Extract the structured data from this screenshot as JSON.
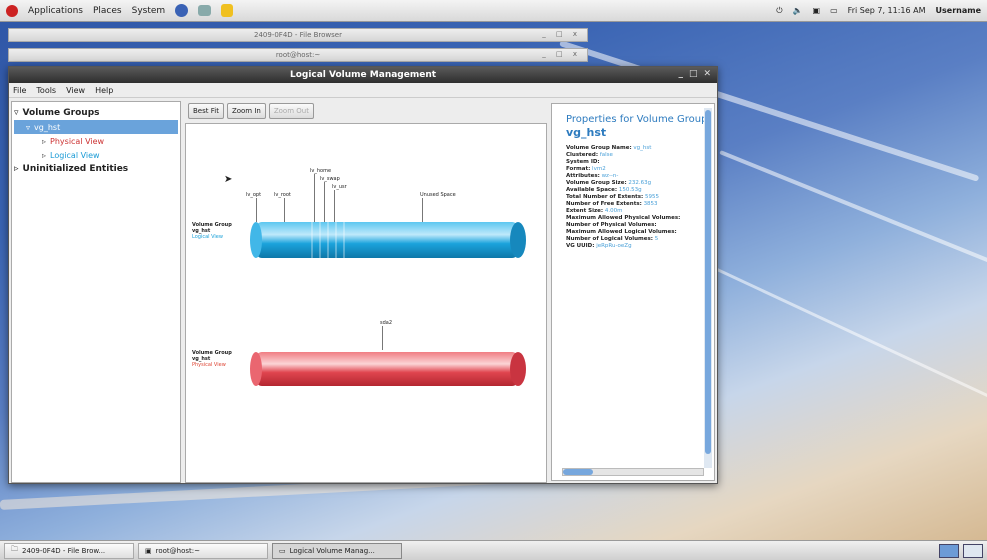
{
  "panel": {
    "menus": [
      "Applications",
      "Places",
      "System"
    ],
    "clock": "Fri Sep 7, 11:16 AM",
    "user": "Username"
  },
  "background_windows": [
    {
      "title": "2409-0F4D - File Browser"
    },
    {
      "title": "root@host:~"
    }
  ],
  "window": {
    "title": "Logical Volume Management",
    "menus": [
      "File",
      "Tools",
      "View",
      "Help"
    ]
  },
  "tree": {
    "volume_groups": "Volume Groups",
    "vg": "vg_hst",
    "physical_view": "Physical View",
    "logical_view": "Logical View",
    "uninitialized": "Uninitialized Entities"
  },
  "toolbar": {
    "best_fit": "Best Fit",
    "zoom_in": "Zoom In",
    "zoom_out": "Zoom Out"
  },
  "diagram": {
    "logical": {
      "title": "Volume Group",
      "name": "vg_hst",
      "view": "Logical View",
      "volumes": [
        "lv_opt",
        "lv_root",
        "lv_home",
        "lv_swap",
        "lv_usr",
        "Unused Space"
      ]
    },
    "physical": {
      "title": "Volume Group",
      "name": "vg_hst",
      "view": "Physical View",
      "volumes": [
        "sda2"
      ]
    }
  },
  "properties": {
    "heading": "Properties for Volume Group",
    "name": "vg_hst",
    "rows": [
      {
        "k": "Volume Group Name:",
        "v": "vg_hst"
      },
      {
        "k": "Clustered:",
        "v": "false"
      },
      {
        "k": "System ID:",
        "v": ""
      },
      {
        "k": "Format:",
        "v": "lvm2"
      },
      {
        "k": "Attributes:",
        "v": "wz--n-"
      },
      {
        "k": "Volume Group Size:",
        "v": "232.63g"
      },
      {
        "k": "Available Space:",
        "v": "150.53g"
      },
      {
        "k": "Total Number of Extents:",
        "v": "5955"
      },
      {
        "k": "Number of Free Extents:",
        "v": "3853"
      },
      {
        "k": "Extent Size:",
        "v": "4.00m"
      },
      {
        "k": "Maximum Allowed Physical Volumes:",
        "v": ""
      },
      {
        "k": "Number of Physical Volumes:",
        "v": ""
      },
      {
        "k": "Maximum Allowed Logical Volumes:",
        "v": ""
      },
      {
        "k": "Number of Logical Volumes:",
        "v": "5"
      },
      {
        "k": "VG UUID:",
        "v": "jeRpRu-oeZg"
      }
    ]
  },
  "taskbar": {
    "items": [
      "2409-0F4D - File Brow...",
      "root@host:~",
      "Logical Volume Manag..."
    ]
  },
  "colors": {
    "logical_bar": "#1ba3dc",
    "physical_bar": "#e0454f",
    "accent": "#2d7bbf"
  }
}
